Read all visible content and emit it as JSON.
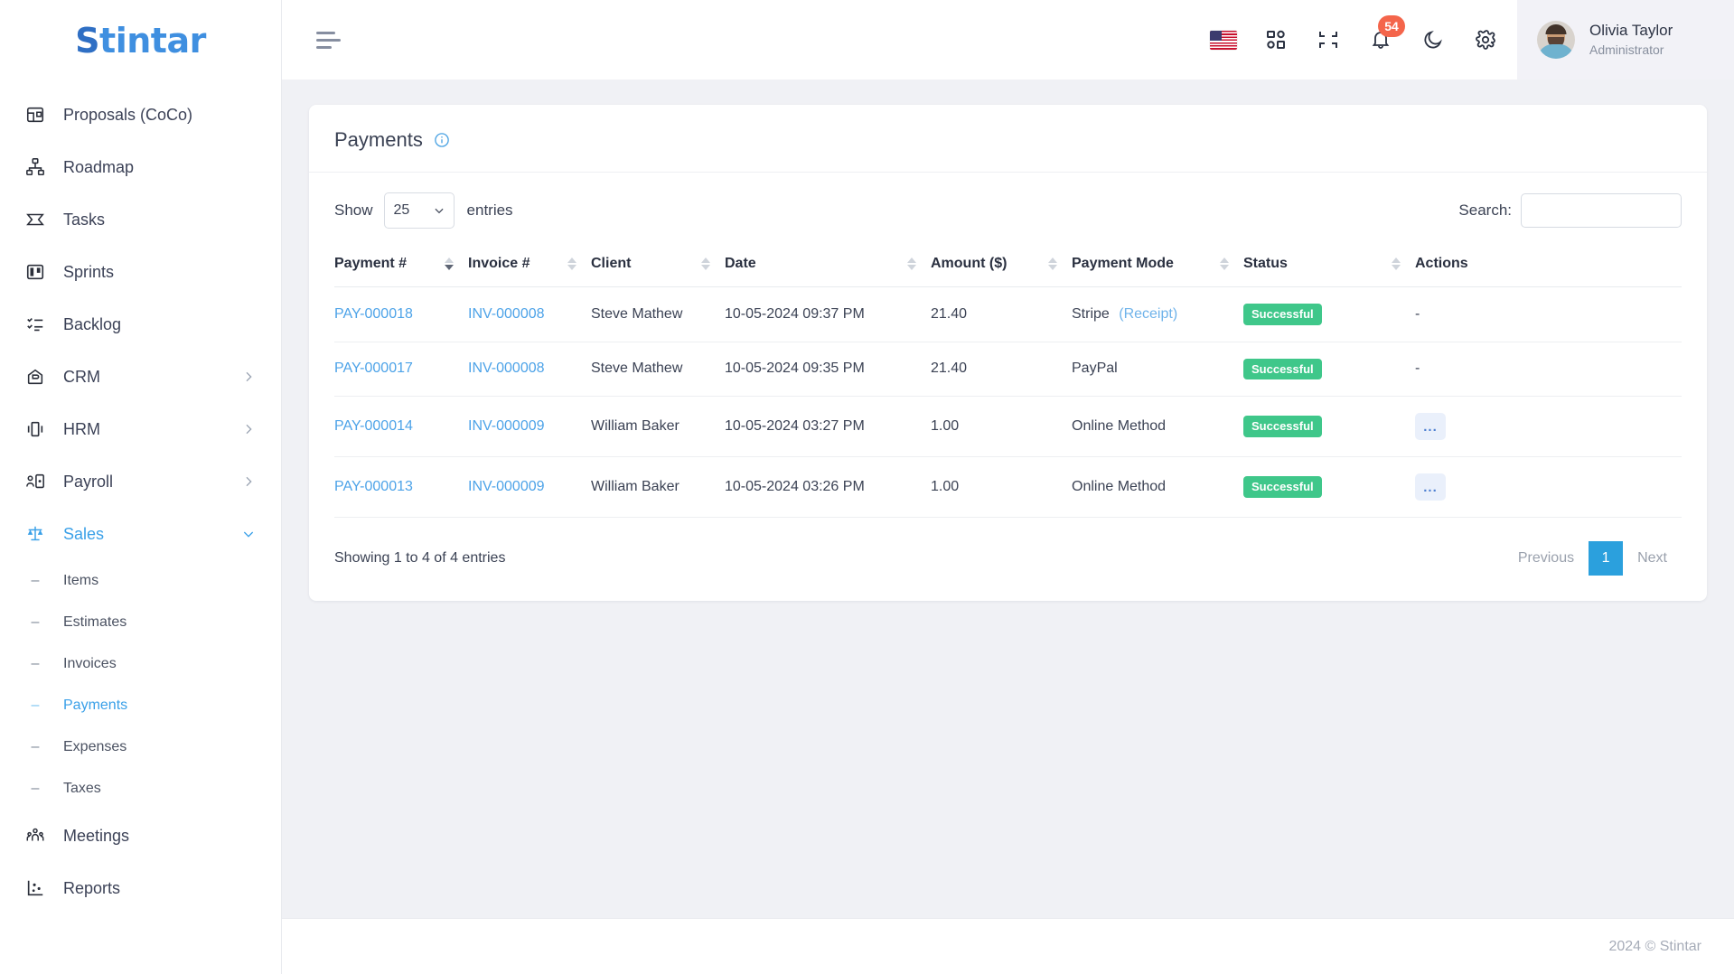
{
  "brand": {
    "logo_s": "S",
    "logo_rest": "tintar",
    "accent": "#3aa0e8"
  },
  "sidebar": {
    "items": [
      {
        "label": "Proposals (CoCo)",
        "icon": "proposal-icon",
        "has_chevron": false,
        "active": false
      },
      {
        "label": "Roadmap",
        "icon": "roadmap-icon",
        "has_chevron": false,
        "active": false
      },
      {
        "label": "Tasks",
        "icon": "tasks-icon",
        "has_chevron": false,
        "active": false
      },
      {
        "label": "Sprints",
        "icon": "sprints-icon",
        "has_chevron": false,
        "active": false
      },
      {
        "label": "Backlog",
        "icon": "backlog-icon",
        "has_chevron": false,
        "active": false
      },
      {
        "label": "CRM",
        "icon": "crm-icon",
        "has_chevron": true,
        "active": false
      },
      {
        "label": "HRM",
        "icon": "hrm-icon",
        "has_chevron": true,
        "active": false
      },
      {
        "label": "Payroll",
        "icon": "payroll-icon",
        "has_chevron": true,
        "active": false
      },
      {
        "label": "Sales",
        "icon": "sales-icon",
        "has_chevron": true,
        "active": true
      }
    ],
    "sales_children": [
      {
        "label": "Items",
        "active": false
      },
      {
        "label": "Estimates",
        "active": false
      },
      {
        "label": "Invoices",
        "active": false
      },
      {
        "label": "Payments",
        "active": true
      },
      {
        "label": "Expenses",
        "active": false
      },
      {
        "label": "Taxes",
        "active": false
      }
    ],
    "items_after": [
      {
        "label": "Meetings",
        "icon": "meetings-icon",
        "has_chevron": false,
        "active": false
      },
      {
        "label": "Reports",
        "icon": "reports-icon",
        "has_chevron": false,
        "active": false
      }
    ]
  },
  "topbar": {
    "menu_toggle": "hamburger-icon",
    "language_flag": "us-flag-icon",
    "apps_grid": "apps-grid-icon",
    "compress": "compress-icon",
    "notifications_icon": "bell-icon",
    "notifications_count": "54",
    "dark_mode": "moon-icon",
    "settings": "gear-icon",
    "user": {
      "name": "Olivia Taylor",
      "role": "Administrator"
    }
  },
  "page": {
    "title": "Payments",
    "info_tooltip_icon": "info-icon"
  },
  "table_controls": {
    "show_label": "Show",
    "entries_value": "25",
    "entries_label": "entries",
    "search_label": "Search:",
    "search_value": "",
    "search_placeholder": ""
  },
  "table": {
    "columns": [
      {
        "label": "Payment #",
        "sortable": true,
        "sort_state": "desc"
      },
      {
        "label": "Invoice #",
        "sortable": true,
        "sort_state": "none"
      },
      {
        "label": "Client",
        "sortable": true,
        "sort_state": "none"
      },
      {
        "label": "Date",
        "sortable": true,
        "sort_state": "none"
      },
      {
        "label": "Amount ($)",
        "sortable": true,
        "sort_state": "none"
      },
      {
        "label": "Payment Mode",
        "sortable": true,
        "sort_state": "none"
      },
      {
        "label": "Status",
        "sortable": true,
        "sort_state": "none"
      },
      {
        "label": "Actions",
        "sortable": false,
        "sort_state": "none"
      }
    ],
    "rows": [
      {
        "payment_no": "PAY-000018",
        "invoice_no": "INV-000008",
        "client": "Steve Mathew",
        "date": "10-05-2024 09:37 PM",
        "amount": "21.40",
        "payment_mode": "Stripe",
        "payment_mode_link": "(Receipt)",
        "status": "Successful",
        "action": "-",
        "action_type": "dash"
      },
      {
        "payment_no": "PAY-000017",
        "invoice_no": "INV-000008",
        "client": "Steve Mathew",
        "date": "10-05-2024 09:35 PM",
        "amount": "21.40",
        "payment_mode": "PayPal",
        "payment_mode_link": "",
        "status": "Successful",
        "action": "-",
        "action_type": "dash"
      },
      {
        "payment_no": "PAY-000014",
        "invoice_no": "INV-000009",
        "client": "William Baker",
        "date": "10-05-2024 03:27 PM",
        "amount": "1.00",
        "payment_mode": "Online Method",
        "payment_mode_link": "",
        "status": "Successful",
        "action": "...",
        "action_type": "button"
      },
      {
        "payment_no": "PAY-000013",
        "invoice_no": "INV-000009",
        "client": "William Baker",
        "date": "10-05-2024 03:26 PM",
        "amount": "1.00",
        "payment_mode": "Online Method",
        "payment_mode_link": "",
        "status": "Successful",
        "action": "...",
        "action_type": "button"
      }
    ]
  },
  "table_footer": {
    "showing_text": "Showing 1 to 4 of 4 entries",
    "previous_label": "Previous",
    "current_page": "1",
    "next_label": "Next"
  },
  "footer": {
    "copyright": "2024 © Stintar"
  },
  "colors": {
    "accent_blue": "#3aa0e8",
    "link_blue": "#4da3e8",
    "success_green": "#3fc78a",
    "badge_red": "#f4654b",
    "page_active": "#2ba0dd"
  }
}
